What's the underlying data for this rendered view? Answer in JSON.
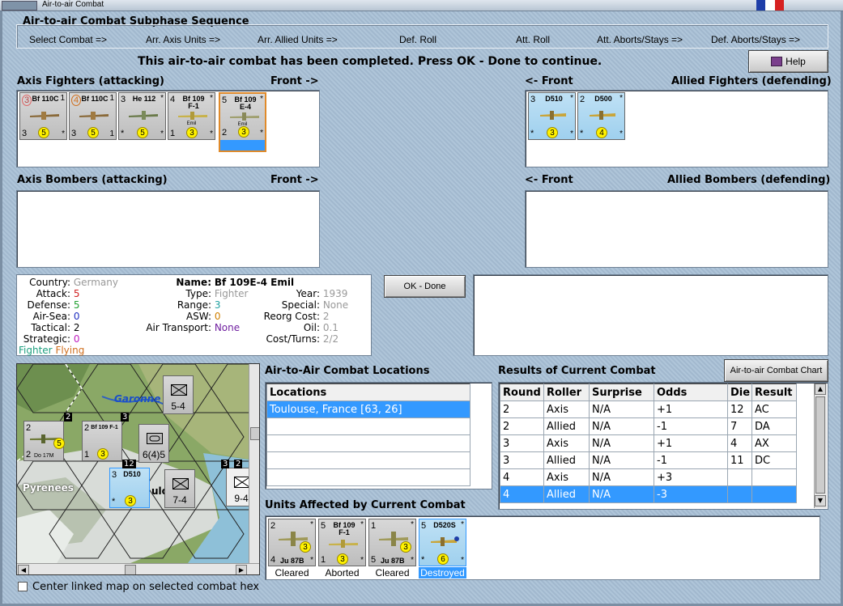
{
  "window": {
    "title": "Air-to-air Combat"
  },
  "header": {
    "title": "Air-to-air Combat Subphase Sequence",
    "phases": [
      "Select Combat =>",
      "Arr. Axis Units =>",
      "Arr. Allied Units =>",
      "Def. Roll",
      "Att. Roll",
      "Att. Aborts/Stays =>",
      "Def. Aborts/Stays =>"
    ]
  },
  "message": "This air-to-air combat has been completed.  Press OK - Done to continue.",
  "help_label": "Help",
  "axis_fighters": {
    "title": "Axis Fighters (attacking)",
    "front": "Front ->",
    "counters": [
      {
        "tl": "3",
        "name": "Bf 110C",
        "tr": "1",
        "sub": "",
        "bl": "3",
        "dot": "5",
        "br": "*"
      },
      {
        "tl": "4",
        "name": "Bf 110C",
        "tr": "1",
        "sub": "",
        "bl": "3",
        "dot": "5",
        "br": "1"
      },
      {
        "tl": "3",
        "name": "He 112",
        "tr": "*",
        "sub": "",
        "bl": "*",
        "dot": "5",
        "br": "*"
      },
      {
        "tl": "4",
        "name": "Bf 109 F-1",
        "tr": "*",
        "sub": "Emil",
        "bl": "1",
        "dot": "3",
        "br": "*"
      },
      {
        "tl": "5",
        "name": "Bf 109 E-4",
        "tr": "*",
        "sub": "Emil",
        "bl": "2",
        "dot": "3",
        "br": "*"
      }
    ]
  },
  "allied_fighters": {
    "title": "Allied Fighters (defending)",
    "front": "<- Front",
    "counters": [
      {
        "tl": "3",
        "name": "D510",
        "tr": "*",
        "sub": "",
        "bl": "*",
        "dot": "3",
        "br": "*"
      },
      {
        "tl": "2",
        "name": "D500",
        "tr": "*",
        "sub": "",
        "bl": "*",
        "dot": "4",
        "br": "*"
      }
    ]
  },
  "axis_bombers": {
    "title": "Axis Bombers (attacking)",
    "front": "Front ->"
  },
  "allied_bombers": {
    "title": "Allied Bombers (defending)",
    "front": "<- Front"
  },
  "unit_info": {
    "country_label": "Country:",
    "country": "Germany",
    "attack_label": "Attack:",
    "attack": "5",
    "defense_label": "Defense:",
    "defense": "5",
    "airsea_label": "Air-Sea:",
    "airsea": "0",
    "tactical_label": "Tactical:",
    "tactical": "2",
    "strategic_label": "Strategic:",
    "strategic": "0",
    "status_1": "Fighter",
    "status_2": "Flying",
    "name_label": "Name:",
    "name": "Bf 109E-4 Emil",
    "type_label": "Type:",
    "type": "Fighter",
    "range_label": "Range:",
    "range": "3",
    "asw_label": "ASW:",
    "asw": "0",
    "air_transport_label": "Air Transport:",
    "air_transport": "None",
    "year_label": "Year:",
    "year": "1939",
    "special_label": "Special:",
    "special": "None",
    "reorg_label": "Reorg Cost:",
    "reorg": "2",
    "oil_label": "Oil:",
    "oil": "0.1",
    "cost_label": "Cost/Turns:",
    "cost": "2/2"
  },
  "ok_done_label": "OK - Done",
  "map": {
    "labels": {
      "river": "Garonne",
      "mountains": "Pyrenees",
      "hex1": "5-4",
      "hex2": "6(4)5",
      "hex3": "7-4",
      "hex4": "9-4",
      "city_partial": "ulo"
    },
    "counters": [
      {
        "tl": "2",
        "name": "",
        "sub": "Do 17M",
        "bl": "2",
        "dot": "5"
      },
      {
        "tl": "2",
        "name": "Bf 109 F-1",
        "sub": "",
        "bl": "1",
        "dot": "3"
      },
      {
        "tl": "3",
        "name": "D510",
        "sub": "",
        "bl": "*",
        "dot": "3"
      }
    ],
    "stack_numbers": [
      "2",
      "3",
      "12",
      "3",
      "2"
    ]
  },
  "center_map_label": "Center linked map on selected combat hex",
  "locations": {
    "title": "Air-to-Air Combat Locations",
    "header": "Locations",
    "rows": [
      "Toulouse, France [63, 26]"
    ]
  },
  "chart_button": "Air-to-air Combat Chart",
  "results": {
    "title": "Results of Current Combat",
    "headers": [
      "Round",
      "Roller",
      "Surprise",
      "Odds",
      "Die",
      "Result"
    ],
    "rows": [
      [
        "2",
        "Axis",
        "N/A",
        "+1",
        "12",
        "AC"
      ],
      [
        "2",
        "Allied",
        "N/A",
        "-1",
        "7",
        "DA"
      ],
      [
        "3",
        "Axis",
        "N/A",
        "+1",
        "4",
        "AX"
      ],
      [
        "3",
        "Allied",
        "N/A",
        "-1",
        "11",
        "DC"
      ],
      [
        "4",
        "Axis",
        "N/A",
        "+3",
        "",
        ""
      ],
      [
        "4",
        "Allied",
        "N/A",
        "-3",
        "",
        ""
      ]
    ]
  },
  "affected": {
    "title": "Units Affected by Current Combat",
    "units": [
      {
        "tl": "2",
        "name": "",
        "tr": "*",
        "bl": "4",
        "sub": "Ju 87B",
        "dot": "3",
        "br": "*",
        "caption": "Cleared"
      },
      {
        "tl": "5",
        "name": "Bf 109 F-1",
        "tr": "*",
        "bl": "1",
        "sub": "",
        "dot": "3",
        "br": "*",
        "caption": "Aborted"
      },
      {
        "tl": "1",
        "name": "",
        "tr": "*",
        "bl": "5",
        "sub": "Ju 87B",
        "dot": "3",
        "br": "*",
        "caption": "Cleared"
      },
      {
        "tl": "5",
        "name": "D520S",
        "tr": "*",
        "bl": "*",
        "sub": "",
        "dot": "6",
        "br": "*",
        "caption": "Destroyed"
      }
    ]
  }
}
